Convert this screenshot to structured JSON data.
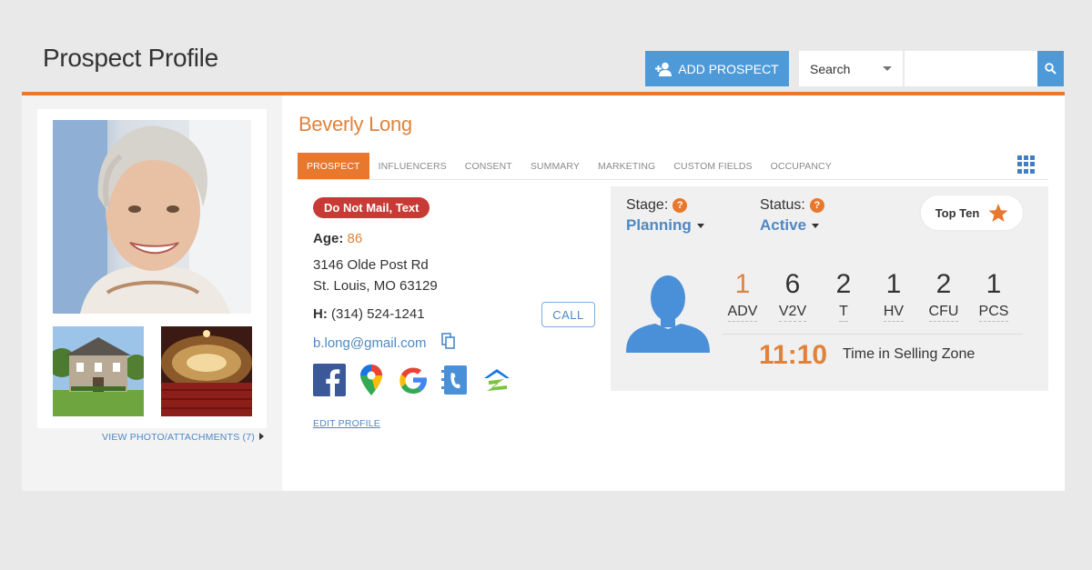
{
  "header": {
    "title": "Prospect Profile",
    "add_button_label": "ADD PROSPECT",
    "search_select_value": "Search",
    "search_input_value": ""
  },
  "left_panel": {
    "view_link": "VIEW PHOTO/ATTACHMENTS (7)"
  },
  "profile": {
    "name": "Beverly Long",
    "tabs": [
      {
        "label": "PROSPECT",
        "active": true
      },
      {
        "label": "INFLUENCERS",
        "active": false
      },
      {
        "label": "CONSENT",
        "active": false
      },
      {
        "label": "SUMMARY",
        "active": false
      },
      {
        "label": "MARKETING",
        "active": false
      },
      {
        "label": "CUSTOM FIELDS",
        "active": false
      },
      {
        "label": "OCCUPANCY",
        "active": false
      }
    ],
    "badge": "Do Not Mail, Text",
    "age_label": "Age:",
    "age_value": "86",
    "address_line1": "3146 Olde Post Rd",
    "address_line2": "St. Louis, MO 63129",
    "phone_label": "H:",
    "phone_value": "(314) 524-1241",
    "call_label": "CALL",
    "email": "b.long@gmail.com",
    "social_icons": [
      "facebook-icon",
      "google-maps-icon",
      "google-icon",
      "phonebook-icon",
      "zillow-icon"
    ],
    "edit_link": "EDIT PROFILE"
  },
  "stats": {
    "stage_label": "Stage:",
    "stage_value": "Planning",
    "status_label": "Status:",
    "status_value": "Active",
    "topten_label": "Top Ten",
    "metrics": [
      {
        "value": "1",
        "label": "ADV",
        "highlight": true
      },
      {
        "value": "6",
        "label": "V2V",
        "highlight": false
      },
      {
        "value": "2",
        "label": "T",
        "highlight": false
      },
      {
        "value": "1",
        "label": "HV",
        "highlight": false
      },
      {
        "value": "2",
        "label": "CFU",
        "highlight": false
      },
      {
        "value": "1",
        "label": "PCS",
        "highlight": false
      }
    ],
    "zone_time": "11:10",
    "zone_label": "Time in Selling Zone"
  },
  "colors": {
    "accent_orange": "#e8782d",
    "link_blue": "#4e88c3",
    "button_blue": "#4e9ad9",
    "badge_red": "#c73a35"
  }
}
